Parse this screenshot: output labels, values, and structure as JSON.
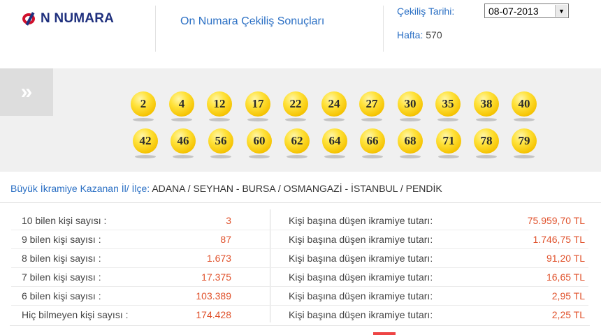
{
  "header": {
    "logo_text": "N NUMARA",
    "title": "On Numara Çekiliş Sonuçları",
    "date_label": "Çekiliş Tarihi:",
    "date_value": "08-07-2013",
    "week_label": "Hafta:",
    "week_value": "570"
  },
  "balls": {
    "row1": [
      "2",
      "4",
      "12",
      "17",
      "22",
      "24",
      "27",
      "30",
      "35",
      "38",
      "40"
    ],
    "row2": [
      "42",
      "46",
      "56",
      "60",
      "62",
      "64",
      "66",
      "68",
      "71",
      "78",
      "79"
    ],
    "color": "#f5c200"
  },
  "winners": {
    "label": "Büyük İkramiye Kazanan İl/ İlçe:",
    "cities": "ADANA / SEYHAN - BURSA / OSMANGAZİ - İSTANBUL / PENDİK"
  },
  "results": [
    {
      "label": "10 bilen kişi sayısı :",
      "count": "3",
      "prize_label": "Kişi başına düşen ikramiye tutarı:",
      "prize": "75.959,70 TL"
    },
    {
      "label": "9 bilen kişi sayısı :",
      "count": "87",
      "prize_label": "Kişi başına düşen ikramiye tutarı:",
      "prize": "1.746,75 TL"
    },
    {
      "label": "8 bilen kişi sayısı :",
      "count": "1.673",
      "prize_label": "Kişi başına düşen ikramiye tutarı:",
      "prize": "91,20 TL"
    },
    {
      "label": "7 bilen kişi sayısı :",
      "count": "17.375",
      "prize_label": "Kişi başına düşen ikramiye tutarı:",
      "prize": "16,65 TL"
    },
    {
      "label": "6 bilen kişi sayısı :",
      "count": "103.389",
      "prize_label": "Kişi başına düşen ikramiye tutarı:",
      "prize": "2,95 TL"
    },
    {
      "label": "Hiç bilmeyen kişi sayısı :",
      "count": "174.428",
      "prize_label": "Kişi başına düşen ikramiye tutarı:",
      "prize": "2,25 TL"
    }
  ],
  "icons": {
    "expand": "double-chevron-right-icon",
    "dropdown": "dropdown-arrow-icon"
  }
}
